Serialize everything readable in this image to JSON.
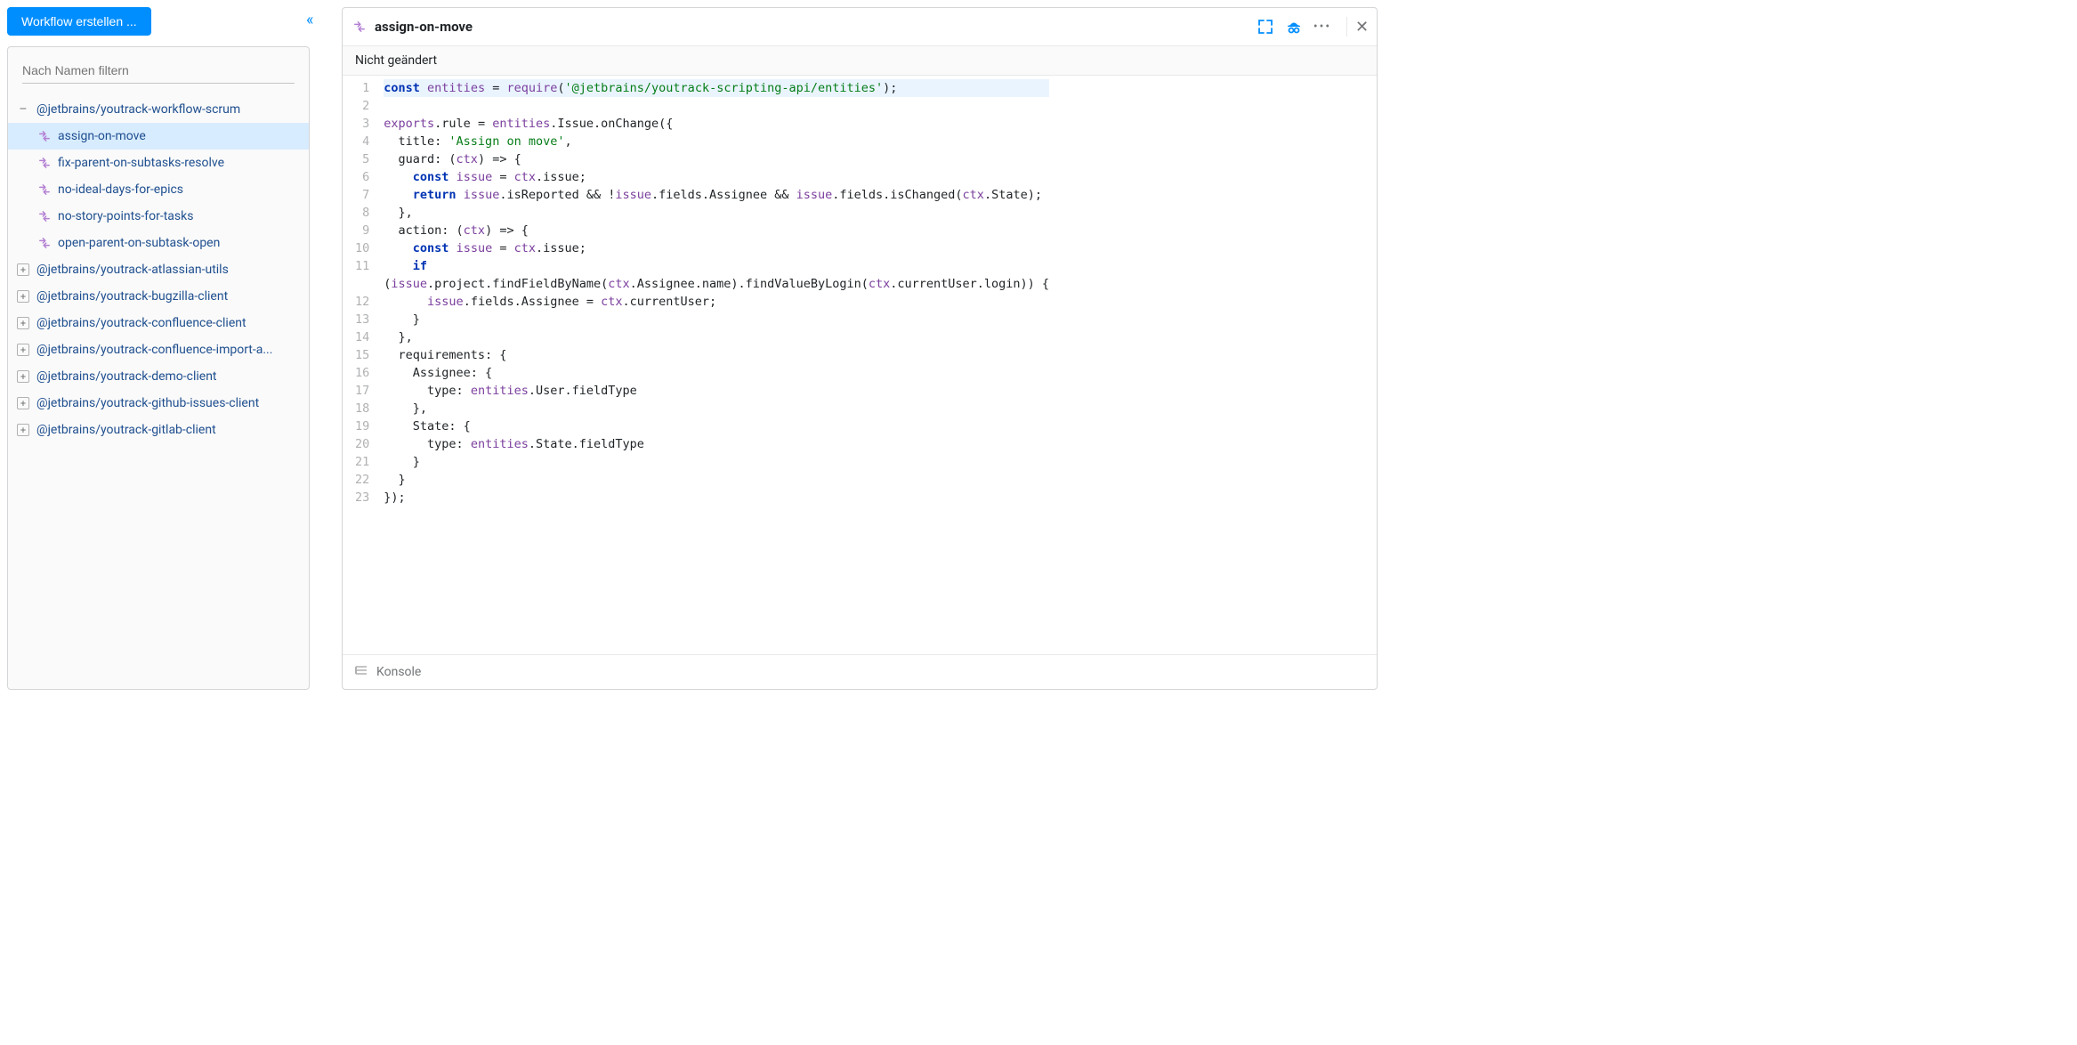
{
  "buttons": {
    "create_workflow": "Workflow erstellen ..."
  },
  "filter": {
    "placeholder": "Nach Namen filtern"
  },
  "tree": {
    "expanded_group": "@jetbrains/youtrack-workflow-scrum",
    "children": [
      "assign-on-move",
      "fix-parent-on-subtasks-resolve",
      "no-ideal-days-for-epics",
      "no-story-points-for-tasks",
      "open-parent-on-subtask-open"
    ],
    "collapsed_groups": [
      "@jetbrains/youtrack-atlassian-utils",
      "@jetbrains/youtrack-bugzilla-client",
      "@jetbrains/youtrack-confluence-client",
      "@jetbrains/youtrack-confluence-import-a...",
      "@jetbrains/youtrack-demo-client",
      "@jetbrains/youtrack-github-issues-client",
      "@jetbrains/youtrack-gitlab-client"
    ],
    "selected_child": "assign-on-move"
  },
  "editor": {
    "title": "assign-on-move",
    "status": "Nicht geändert",
    "lines": [
      [
        [
          "kw",
          "const"
        ],
        [
          "sp",
          " "
        ],
        [
          "id",
          "entities"
        ],
        [
          "sp",
          " = "
        ],
        [
          "fn",
          "require"
        ],
        [
          "sp",
          "("
        ],
        [
          "str",
          "'@jetbrains/youtrack-scripting-api/entities'"
        ],
        [
          "sp",
          ");"
        ]
      ],
      [],
      [
        [
          "id",
          "exports"
        ],
        [
          "sp",
          ".rule = "
        ],
        [
          "id",
          "entities"
        ],
        [
          "sp",
          ".Issue.onChange({"
        ]
      ],
      [
        [
          "sp",
          "  title: "
        ],
        [
          "str",
          "'Assign on move'"
        ],
        [
          "sp",
          ","
        ]
      ],
      [
        [
          "sp",
          "  guard: ("
        ],
        [
          "id",
          "ctx"
        ],
        [
          "sp",
          ") => {"
        ]
      ],
      [
        [
          "sp",
          "    "
        ],
        [
          "kw",
          "const"
        ],
        [
          "sp",
          " "
        ],
        [
          "id",
          "issue"
        ],
        [
          "sp",
          " = "
        ],
        [
          "id",
          "ctx"
        ],
        [
          "sp",
          ".issue;"
        ]
      ],
      [
        [
          "sp",
          "    "
        ],
        [
          "kw",
          "return"
        ],
        [
          "sp",
          " "
        ],
        [
          "id",
          "issue"
        ],
        [
          "sp",
          ".isReported && !"
        ],
        [
          "id",
          "issue"
        ],
        [
          "sp",
          ".fields.Assignee && "
        ],
        [
          "id",
          "issue"
        ],
        [
          "sp",
          ".fields.isChanged("
        ],
        [
          "id",
          "ctx"
        ],
        [
          "sp",
          ".State);"
        ]
      ],
      [
        [
          "sp",
          "  },"
        ]
      ],
      [
        [
          "sp",
          "  action: ("
        ],
        [
          "id",
          "ctx"
        ],
        [
          "sp",
          ") => {"
        ]
      ],
      [
        [
          "sp",
          "    "
        ],
        [
          "kw",
          "const"
        ],
        [
          "sp",
          " "
        ],
        [
          "id",
          "issue"
        ],
        [
          "sp",
          " = "
        ],
        [
          "id",
          "ctx"
        ],
        [
          "sp",
          ".issue;"
        ]
      ],
      [
        [
          "sp",
          "    "
        ],
        [
          "kw",
          "if"
        ]
      ],
      [
        [
          "sp",
          "("
        ],
        [
          "id",
          "issue"
        ],
        [
          "sp",
          ".project.findFieldByName("
        ],
        [
          "id",
          "ctx"
        ],
        [
          "sp",
          ".Assignee.name).findValueByLogin("
        ],
        [
          "id",
          "ctx"
        ],
        [
          "sp",
          ".currentUser.login)) {"
        ]
      ],
      [
        [
          "sp",
          "      "
        ],
        [
          "id",
          "issue"
        ],
        [
          "sp",
          ".fields.Assignee = "
        ],
        [
          "id",
          "ctx"
        ],
        [
          "sp",
          ".currentUser;"
        ]
      ],
      [
        [
          "sp",
          "    }"
        ]
      ],
      [
        [
          "sp",
          "  },"
        ]
      ],
      [
        [
          "sp",
          "  requirements: {"
        ]
      ],
      [
        [
          "sp",
          "    Assignee: {"
        ]
      ],
      [
        [
          "sp",
          "      type: "
        ],
        [
          "id",
          "entities"
        ],
        [
          "sp",
          ".User.fieldType"
        ]
      ],
      [
        [
          "sp",
          "    },"
        ]
      ],
      [
        [
          "sp",
          "    State: {"
        ]
      ],
      [
        [
          "sp",
          "      type: "
        ],
        [
          "id",
          "entities"
        ],
        [
          "sp",
          ".State.fieldType"
        ]
      ],
      [
        [
          "sp",
          "    }"
        ]
      ],
      [
        [
          "sp",
          "  }"
        ]
      ],
      [
        [
          "sp",
          "});"
        ]
      ]
    ],
    "line_numbers": [
      1,
      2,
      3,
      4,
      5,
      6,
      7,
      8,
      9,
      10,
      11,
      null,
      12,
      13,
      14,
      15,
      16,
      17,
      18,
      19,
      20,
      21,
      22,
      23
    ]
  },
  "console": {
    "label": "Konsole"
  }
}
